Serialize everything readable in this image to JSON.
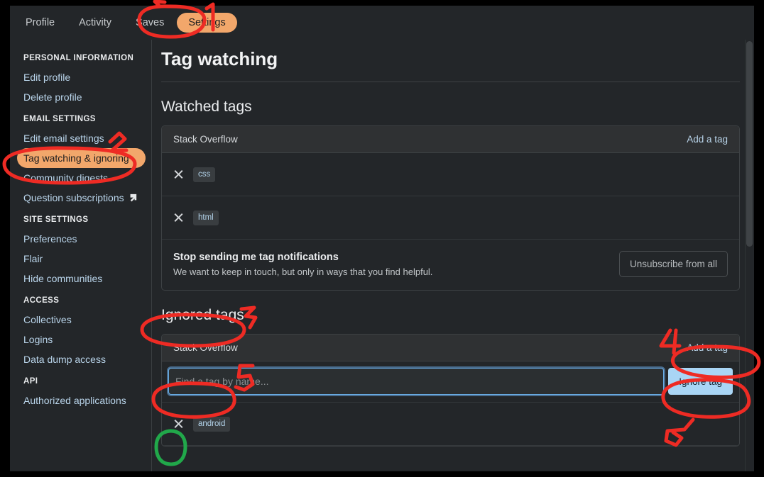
{
  "topnav": {
    "tabs": [
      {
        "label": "Profile",
        "active": false
      },
      {
        "label": "Activity",
        "active": false
      },
      {
        "label": "Saves",
        "active": false
      },
      {
        "label": "Settings",
        "active": true
      }
    ]
  },
  "sidebar": {
    "groups": [
      {
        "heading": "PERSONAL INFORMATION",
        "items": [
          {
            "label": "Edit profile"
          },
          {
            "label": "Delete profile"
          }
        ]
      },
      {
        "heading": "EMAIL SETTINGS",
        "items": [
          {
            "label": "Edit email settings"
          },
          {
            "label": "Tag watching & ignoring",
            "highlight": true
          },
          {
            "label": "Community digests"
          },
          {
            "label": "Question subscriptions",
            "external": true
          }
        ]
      },
      {
        "heading": "SITE SETTINGS",
        "items": [
          {
            "label": "Preferences"
          },
          {
            "label": "Flair"
          },
          {
            "label": "Hide communities"
          }
        ]
      },
      {
        "heading": "ACCESS",
        "items": [
          {
            "label": "Collectives"
          },
          {
            "label": "Logins"
          },
          {
            "label": "Data dump access"
          }
        ]
      },
      {
        "heading": "API",
        "items": [
          {
            "label": "Authorized applications"
          }
        ]
      }
    ]
  },
  "main": {
    "page_title": "Tag watching",
    "watched": {
      "section_title": "Watched tags",
      "site_name": "Stack Overflow",
      "add_tag_label": "Add a tag",
      "tags": [
        "css",
        "html"
      ],
      "unsubscribe": {
        "title": "Stop sending me tag notifications",
        "subtitle": "We want to keep in touch, but only in ways that you find helpful.",
        "button_label": "Unsubscribe from all"
      }
    },
    "ignored": {
      "section_title": "Ignored tags",
      "site_name": "Stack Overflow",
      "add_tag_label": "Add a tag",
      "input_placeholder": "Find a tag by name...",
      "input_value": "",
      "submit_label": "Ignore tag",
      "tags": [
        "android"
      ]
    }
  },
  "annotations": {
    "marks": [
      {
        "number": "1",
        "target": "settings-tab",
        "color": "#ee2b24"
      },
      {
        "number": "2",
        "target": "sidebar-item-tag-watching-ignoring",
        "color": "#ee2b24"
      },
      {
        "number": "3",
        "target": "ignored-tags-heading",
        "color": "#ee2b24"
      },
      {
        "number": "4",
        "target": "ignored-add-a-tag-link",
        "color": "#ee2b24"
      },
      {
        "number": "5",
        "target": "find-a-tag-input",
        "color": "#ee2b24"
      },
      {
        "number": "6",
        "target": "ignore-tag-button",
        "color": "#ee2b24"
      },
      {
        "number": "",
        "target": "remove-android-tag-button",
        "color": "#21a84a"
      }
    ]
  },
  "colors": {
    "page_bg": "#232629",
    "accent_highlight": "#f2a76b",
    "link": "#b9d4ea",
    "primary_button": "#a9d5f5",
    "annotation_red": "#ee2b24",
    "annotation_green": "#21a84a"
  }
}
